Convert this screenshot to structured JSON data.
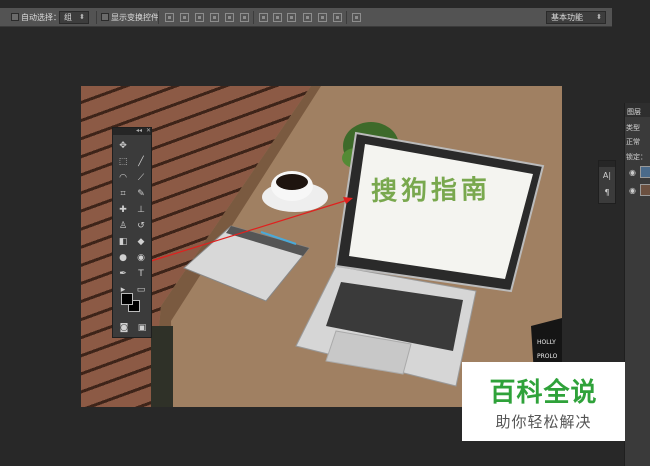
{
  "options_bar": {
    "auto_select_label": "自动选择：",
    "auto_select_value": "组",
    "show_transform_label": "显示变换控件",
    "workspace_value": "基本功能"
  },
  "document": {
    "screen_text": "搜狗指南",
    "sign_text_1": "HOLLY",
    "sign_text_2": "PROLO"
  },
  "tools_panel": {
    "collapse_glyph": "◂◂",
    "close_glyph": "✕"
  },
  "mini_panel": {
    "char_label": "A|",
    "para_label": "¶"
  },
  "layers_panel": {
    "tab_label": "图层",
    "kind_label": "类型",
    "blend_label": "正常",
    "lock_label": "锁定："
  },
  "watermark": {
    "title": "百科全说",
    "subtitle": "助你轻松解决"
  },
  "colors": {
    "accent_green": "#2fa23a",
    "arrow_red": "#e0201e",
    "screen_text": "#79a84e"
  }
}
